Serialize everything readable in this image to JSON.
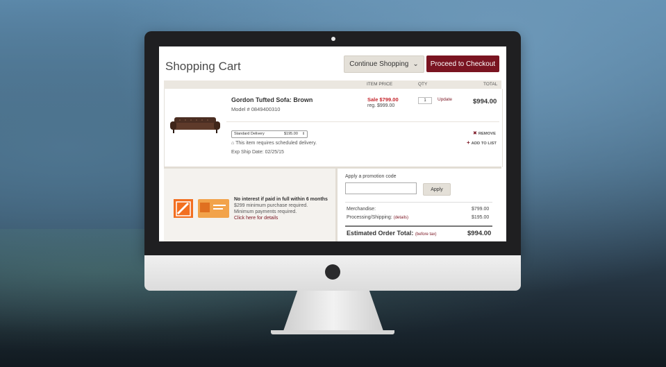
{
  "header": {
    "title": "Shopping Cart",
    "continue_label": "Continue Shopping",
    "checkout_label": "Proceed to Checkout"
  },
  "table": {
    "columns": [
      "ITEM PRICE",
      "QTY",
      "TOTAL"
    ]
  },
  "item": {
    "name": "Gordon Tufted Sofa: Brown",
    "model": "Model # 0849400310",
    "sale_price": "Sale $799.00",
    "reg_price": "reg. $999.00",
    "qty": "1",
    "update_label": "Update",
    "total": "$994.00",
    "delivery_option": "Standard Delivery",
    "delivery_price": "$195.00",
    "delivery_note": "This item requires scheduled delivery.",
    "ship_date": "Exp Ship Date: 02/25/15",
    "remove_label": "REMOVE",
    "add_to_list_label": "ADD TO LIST"
  },
  "financing": {
    "headline": "No interest if paid in full within 6 months",
    "minimum": "$299 minimum purchase required.",
    "requirement": "Minimum payments required.",
    "link": "Click here for details"
  },
  "promo": {
    "label": "Apply a promotion code",
    "input_value": "",
    "apply_label": "Apply"
  },
  "summary": {
    "merchandise_label": "Merchandise:",
    "merchandise_value": "$799.00",
    "shipping_label": "Processing/Shipping:",
    "shipping_details": "(details)",
    "shipping_value": "$195.00",
    "total_label": "Estimated Order Total:",
    "total_note": "(before tax)",
    "total_value": "$994.00"
  },
  "colors": {
    "brand": "#7a1421",
    "sale": "#c4242b",
    "orange": "#f26f21"
  }
}
